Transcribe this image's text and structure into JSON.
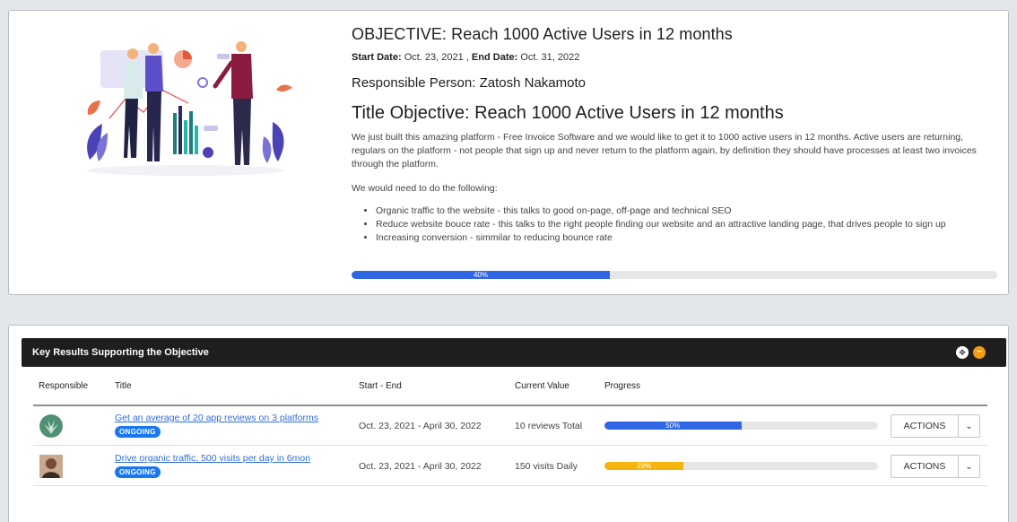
{
  "objective": {
    "heading": "OBJECTIVE: Reach 1000 Active Users in 12 months",
    "start_date_label": "Start Date:",
    "start_date": "Oct. 23, 2021",
    "separator": ",",
    "end_date_label": "End Date:",
    "end_date": "Oct. 31, 2022",
    "responsible_label": "Responsible Person:",
    "responsible_name": "Zatosh Nakamoto",
    "title_objective": "Title Objective: Reach 1000 Active Users in 12 months",
    "paragraph_1": "We just built this amazing platform - Free Invoice Software and we would like to get it to 1000 active users in 12 months. Active users are returning, regulars on the platform - not people that sign up and never return to the platform again, by definition they should have processes at least two invoices through the platform.",
    "paragraph_2": "We would need to do the following:",
    "bullets": [
      "Organic traffic to the website - this talks to good on-page, off-page and technical SEO",
      "Reduce website bouce rate - this talks to the right people finding our website and an attractive landing page, that drives people to sign up",
      "Increasing conversion - simmilar to reducing bounce rate"
    ],
    "progress": 40,
    "progress_label": "40%",
    "progress_color": "#2f66e3"
  },
  "key_results": {
    "header": "Key Results Supporting the Objective",
    "expand_icon": "expand-icon",
    "collapse_icon": "collapse-icon",
    "columns": {
      "responsible": "Responsible",
      "title": "Title",
      "start_end": "Start - End",
      "current_value": "Current Value",
      "progress": "Progress"
    },
    "rows": [
      {
        "title": "Get an average of 20 app reviews on 3 platforms",
        "status": "ONGOING",
        "start_end": "Oct. 23, 2021 - April 30, 2022",
        "current_value": "10 reviews Total",
        "progress": 50,
        "progress_label": "50%",
        "progress_color": "#2f66e3",
        "actions_label": "ACTIONS"
      },
      {
        "title": "Drive organic traffic, 500 visits per day in 6mon",
        "status": "ONGOING",
        "start_end": "Oct. 23, 2021 - April 30, 2022",
        "current_value": "150 visits Daily",
        "progress": 29,
        "progress_label": "29%",
        "progress_color": "#f5b50e",
        "actions_label": "ACTIONS"
      }
    ]
  },
  "colors": {
    "accent": "#1877f2",
    "header_bg": "#1e1e1e",
    "collapse": "#f39c12"
  }
}
